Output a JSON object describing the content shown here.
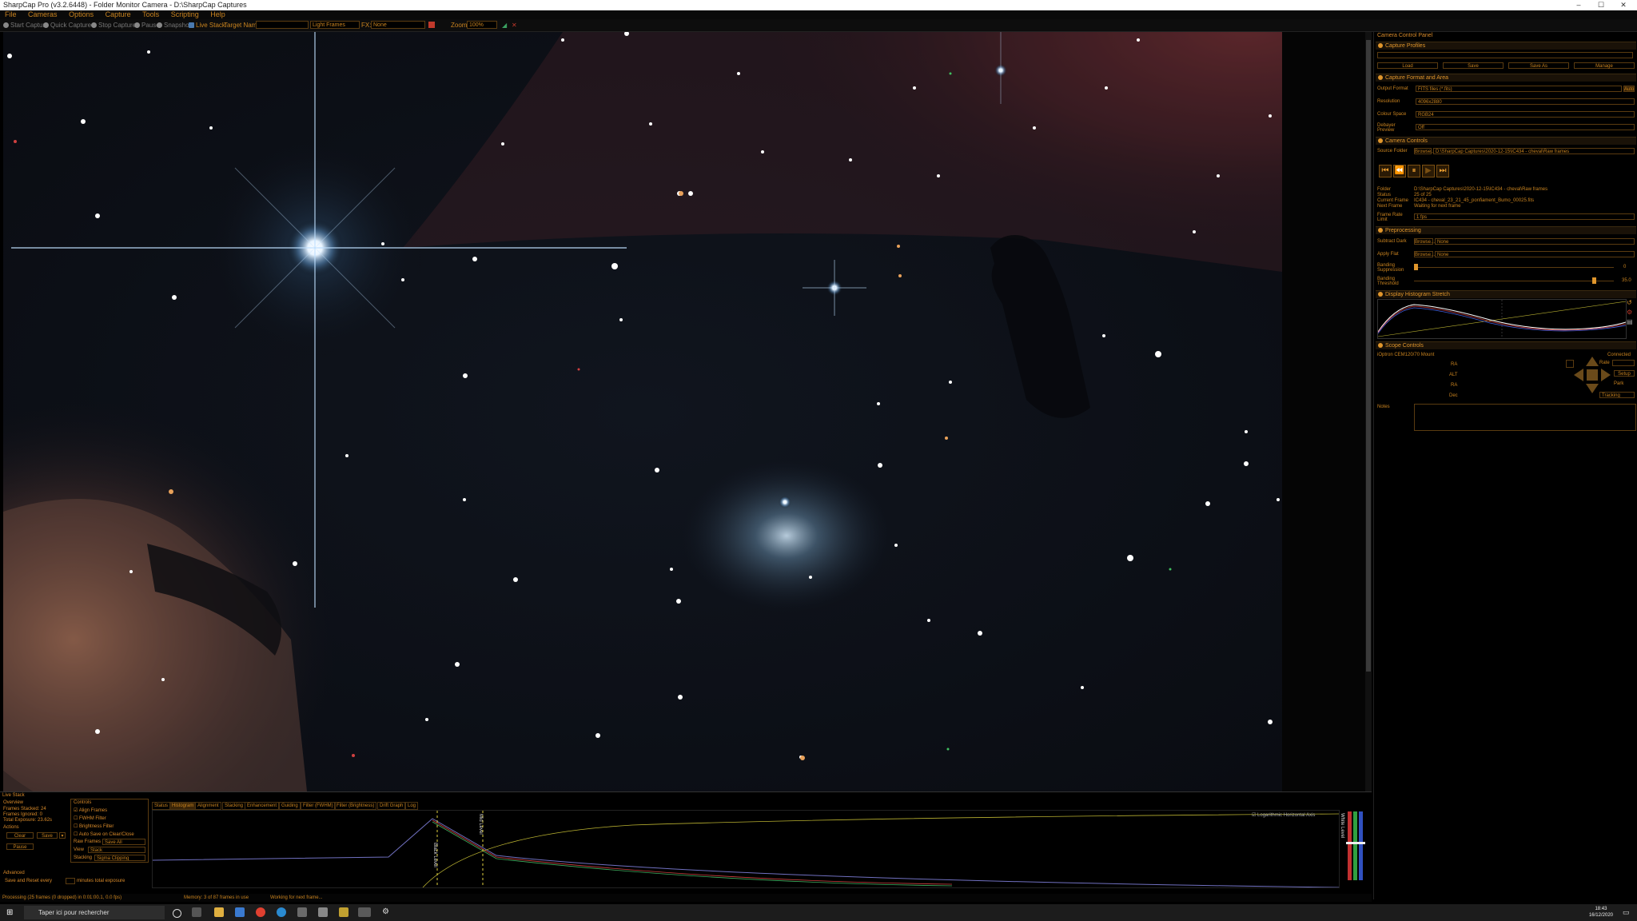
{
  "window": {
    "title": "SharpCap Pro (v3.2.6448) - Folder Monitor Camera - D:\\SharpCap Captures",
    "minimize": "–",
    "maximize": "☐",
    "close": "✕"
  },
  "menu": [
    "File",
    "Cameras",
    "Options",
    "Capture",
    "Tools",
    "Scripting",
    "Help"
  ],
  "toolbar": {
    "start_capture": "Start Capture",
    "quick_capture": "Quick Capture",
    "stop_capture": "Stop Capture",
    "pause": "Pause",
    "snapshot": "Snapshot",
    "live_stack": "Live Stack",
    "target_name_label": "Target Name:",
    "target_name_value": "",
    "frame_type": "Light Frames",
    "fx_label": "FX:",
    "fx_value": "None",
    "zoom_label": "Zoom:",
    "zoom_value": "100%"
  },
  "panel": {
    "title": "Camera Control Panel",
    "capture_profiles": {
      "title": "Capture Profiles",
      "buttons": [
        "Load",
        "Save",
        "Save As",
        "Manage"
      ]
    },
    "format": {
      "title": "Capture Format and Area",
      "rows": [
        {
          "label": "Output Format",
          "value": "FITS files (*.fits)"
        },
        {
          "label": "Resolution",
          "value": "4096x2880"
        },
        {
          "label": "Colour Space",
          "value": "RGB24"
        },
        {
          "label": "Debayer Preview",
          "value": "Off"
        }
      ],
      "auto": "Auto"
    },
    "camera": {
      "title": "Camera Controls",
      "source_folder_label": "Source Folder",
      "browse": "Browse...",
      "source_folder_value": "D:\\SharpCap Captures\\2020-12-15\\IC434 - cheval\\Raw frames",
      "transport": [
        "⏮",
        "⏪",
        "⏸",
        "▶",
        "⏭"
      ],
      "info": [
        {
          "label": "Folder",
          "value": "D:\\SharpCap Captures\\2020-12-15\\IC434 - cheval\\Raw frames"
        },
        {
          "label": "Status",
          "value": "25 of 25"
        },
        {
          "label": "Current Frame",
          "value": "IC434 - cheval_23_21_45_ponfiament_Bumo_00025.fits"
        },
        {
          "label": "Next Frame",
          "value": "Waiting for next frame"
        }
      ],
      "frame_rate_label": "Frame Rate Limit",
      "frame_rate_value": "1 fps"
    },
    "preprocessing": {
      "title": "Preprocessing",
      "subtract_dark_label": "Subtract Dark",
      "subtract_dark_value": "None",
      "apply_flat_label": "Apply Flat",
      "apply_flat_value": "None",
      "browse": "Browse...",
      "banding_suppression_label": "Banding Suppression",
      "banding_suppression_value": "0",
      "banding_threshold_label": "Banding Threshold",
      "banding_threshold_value": "35.0"
    },
    "histogram": {
      "title": "Display Histogram Stretch"
    },
    "scope": {
      "title": "Scope Controls",
      "mount": "iOptron CEM120/70 Mount",
      "connected": "Connected",
      "axes": [
        "RA",
        "ALT",
        "RA",
        "Dec"
      ],
      "rate_label": "Rate",
      "setup": "Setup",
      "park": "Park",
      "tracking": "Tracking"
    },
    "notes_label": "Notes"
  },
  "livestack": {
    "title": "Live Stack",
    "overview_title": "Overview",
    "frames_stacked": "Frames Stacked: 24",
    "frames_ignored": "Frames Ignored: 0",
    "total_exposure": "Total Exposure: 23.62s",
    "actions_title": "Actions",
    "clear": "Clear",
    "save": "Save",
    "pause": "Pause",
    "advanced_title": "Advanced",
    "save_reset": "Save and Reset every",
    "save_reset_tail": "minutes total exposure",
    "controls_title": "Controls",
    "align_frames": "Align Frames",
    "fwhm_filter": "FWHM Filter",
    "brightness_filter": "Brightness Filter",
    "autosave": "Auto Save on Clear/Close",
    "raw_frames_label": "Raw Frames",
    "raw_frames_value": "Save All",
    "view_label": "View",
    "view_value": "Stack",
    "stacking_label": "Stacking",
    "stacking_value": "Sigma Clipping",
    "tabs": [
      "Status",
      "Histogram",
      "Alignment",
      "Stacking",
      "Enhancement",
      "Guiding",
      "Filter (FWHM)",
      "Filter (Brightness)",
      "Drift Graph",
      "Log"
    ],
    "log_label": "Logarithmic Horizontal Axis",
    "black_level": "Black Level",
    "mid_level": "Mid Level",
    "white_level": "White Level"
  },
  "status": {
    "processing": "Processing (25 frames (0 dropped) in 0:01:00.1, 0.0 fps)",
    "memory": "Memory: 3 of 87 frames in use",
    "working": "Working for next frame..."
  },
  "taskbar": {
    "search_placeholder": "Taper ici pour rechercher",
    "time": "18:43",
    "date": "16/12/2020"
  },
  "colors": {
    "accent": "#d88a2a",
    "bg": "#000000",
    "border": "#5a3b10"
  }
}
